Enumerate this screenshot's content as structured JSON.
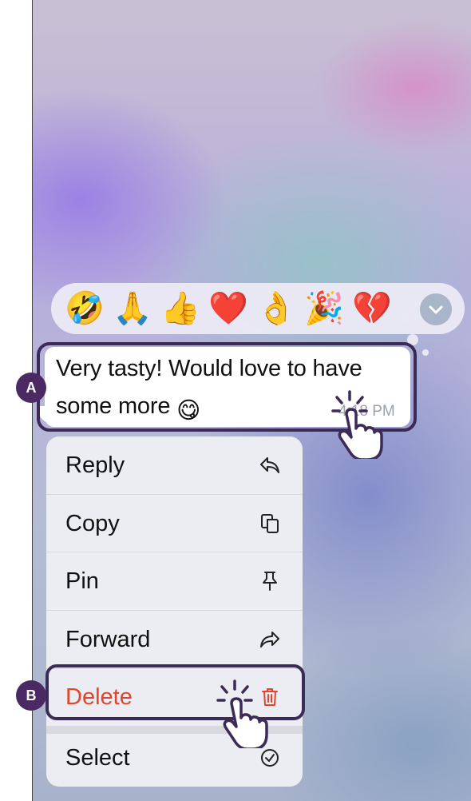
{
  "reactions": [
    {
      "name": "rofl",
      "glyph": "🤣"
    },
    {
      "name": "pray",
      "glyph": "🙏"
    },
    {
      "name": "thumbs-up",
      "glyph": "👍"
    },
    {
      "name": "red-heart",
      "glyph": "❤️"
    },
    {
      "name": "ok-hand",
      "glyph": "👌"
    },
    {
      "name": "party-popper",
      "glyph": "🎉"
    },
    {
      "name": "broken-heart",
      "glyph": "💔"
    }
  ],
  "message": {
    "text": "Very tasty! Would love to have some more",
    "emoji": "😋",
    "time": "4:18 PM"
  },
  "menu": {
    "reply": "Reply",
    "copy": "Copy",
    "pin": "Pin",
    "forward": "Forward",
    "delete": "Delete",
    "select": "Select"
  },
  "badges": {
    "a": "A",
    "b": "B"
  },
  "colors": {
    "badge": "#4b2a63",
    "highlight": "#3d2b57",
    "delete": "#e0452e"
  }
}
